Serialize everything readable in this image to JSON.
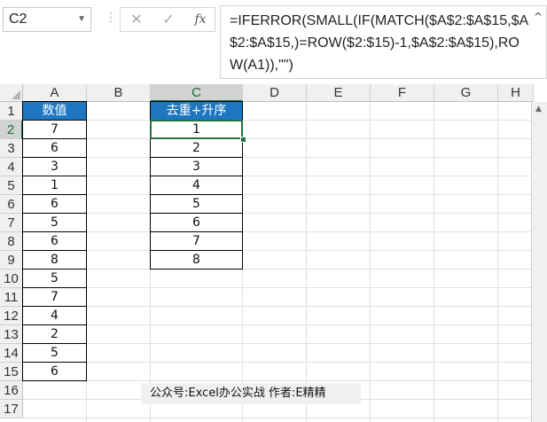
{
  "name_box": {
    "value": "C2",
    "dropdown_icon": "chevron-down-icon"
  },
  "formula_bar": {
    "separator": "⋮",
    "cancel_icon": "✕",
    "enter_icon": "✓",
    "fx_label": "fx",
    "formula": "=IFERROR(SMALL(IF(MATCH($A$2:$A$15,$A$2:$A$15,)=ROW($2:$15)-1,$A$2:$A$15),ROW(A1)),\"\")",
    "collapse_icon": "^"
  },
  "columns": [
    "A",
    "B",
    "C",
    "D",
    "E",
    "F",
    "G",
    "H"
  ],
  "rows": [
    "1",
    "2",
    "3",
    "4",
    "5",
    "6",
    "7",
    "8",
    "9",
    "10",
    "11",
    "12",
    "13",
    "14",
    "15",
    "16",
    "17"
  ],
  "active_cell": {
    "column": "C",
    "row": "2"
  },
  "colors": {
    "header_fill": "#1f77c2",
    "header_text": "#ffffff",
    "selection": "#217346"
  },
  "table_a": {
    "header": "数值",
    "values": [
      "7",
      "6",
      "3",
      "1",
      "6",
      "5",
      "6",
      "8",
      "5",
      "7",
      "4",
      "2",
      "5",
      "6"
    ]
  },
  "table_c": {
    "header": "去重+升序",
    "values": [
      "1",
      "2",
      "3",
      "4",
      "5",
      "6",
      "7",
      "8"
    ]
  },
  "watermark": "公众号:Excel办公实战  作者:E精精",
  "scrollbar": {
    "up_arrow": "▲"
  }
}
